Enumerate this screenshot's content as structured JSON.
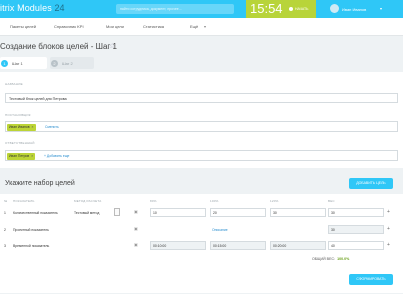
{
  "header": {
    "logo_text": "itrix Modules",
    "logo_number": "24",
    "search_placeholder": "найти сотрудника, документ, прочее...",
    "clock": "15:54",
    "start_label": "НАЧАТЬ",
    "user_name": "Иван Иванов"
  },
  "nav": {
    "items": [
      "Пакеты целей",
      "Справочник KPI",
      "Мои цели",
      "Статистика",
      "Ещё"
    ]
  },
  "page": {
    "title": "Создание блоков целей - Шаг 1",
    "steps": [
      {
        "num": "1",
        "label": "Шаг 1"
      },
      {
        "num": "2",
        "label": "Шаг 2"
      }
    ]
  },
  "form": {
    "name_label": "НАЗВАНИЕ",
    "name_value": "Тестовый блок целей для Петрова",
    "setter_label": "ПОСТАНОВЩИК",
    "setter_person": "Иван Иванов",
    "setter_action": "Сменить",
    "responsible_label": "ОТВЕТСТВЕННЫЙ",
    "responsible_person": "Иван Петров",
    "responsible_action": "+ Добавить еще"
  },
  "goals": {
    "section_title": "Укажите набор целей",
    "add_button": "ДОБАВИТЬ ЦЕЛЬ",
    "columns": [
      "№",
      "ПОКАЗАТЕЛЬ",
      "МЕТОД РАСЧЕТА",
      "80%",
      "100%",
      "120%",
      "ВЕС"
    ],
    "rows": [
      {
        "num": "1",
        "name": "Количественный показатель",
        "method": "Тестовый метод",
        "v80": "10",
        "v100": "20",
        "v120": "30",
        "weight": "30"
      },
      {
        "num": "2",
        "name": "Проектный показатель",
        "method": "",
        "v80": "",
        "v100": "Описание",
        "v120": "",
        "weight": "30"
      },
      {
        "num": "3",
        "name": "Временной показатель",
        "method": "",
        "v80": "00:10:00",
        "v100": "00:15:00",
        "v120": "00:20:00",
        "weight": "40"
      }
    ],
    "total_label": "ОБЩИЙ ВЕС:",
    "total_value": "100.0%",
    "save_button": "СФОРМИРОВАТЬ"
  }
}
